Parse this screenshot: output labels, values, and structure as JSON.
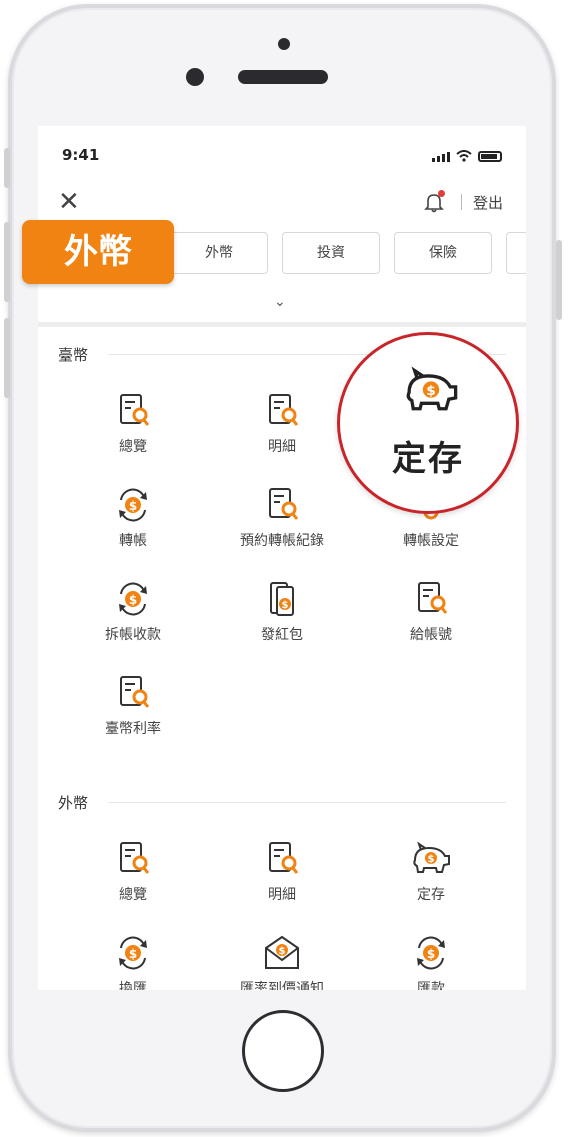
{
  "status": {
    "time": "9:41"
  },
  "header": {
    "logout": "登出"
  },
  "overlay": {
    "badge": "外幣",
    "zoom_label": "定存"
  },
  "tabs": [
    {
      "label": "外幣"
    },
    {
      "label": "投資"
    },
    {
      "label": "保險"
    }
  ],
  "sections": {
    "twd": {
      "title": "臺幣",
      "items": [
        {
          "label": "總覽",
          "icon": "document-search-icon"
        },
        {
          "label": "明細",
          "icon": "document-search-icon"
        },
        {
          "label": "轉帳",
          "icon": "transfer-icon"
        },
        {
          "label": "預約轉帳紀錄",
          "icon": "document-search-icon"
        },
        {
          "label": "轉帳設定",
          "icon": "gear-icon"
        },
        {
          "label": "拆帳收款",
          "icon": "transfer-icon"
        },
        {
          "label": "發紅包",
          "icon": "red-envelope-icon"
        },
        {
          "label": "給帳號",
          "icon": "document-search-icon"
        },
        {
          "label": "臺幣利率",
          "icon": "document-search-icon"
        }
      ]
    },
    "fx": {
      "title": "外幣",
      "items": [
        {
          "label": "總覽",
          "icon": "document-search-icon"
        },
        {
          "label": "明細",
          "icon": "document-search-icon"
        },
        {
          "label": "定存",
          "icon": "piggy-bank-icon"
        },
        {
          "label": "換匯",
          "icon": "transfer-icon"
        },
        {
          "label": "匯率到價通知",
          "icon": "mail-icon"
        },
        {
          "label": "匯款",
          "icon": "transfer-icon"
        }
      ]
    }
  },
  "colors": {
    "accent": "#f08312",
    "highlight_ring": "#c8252b"
  }
}
